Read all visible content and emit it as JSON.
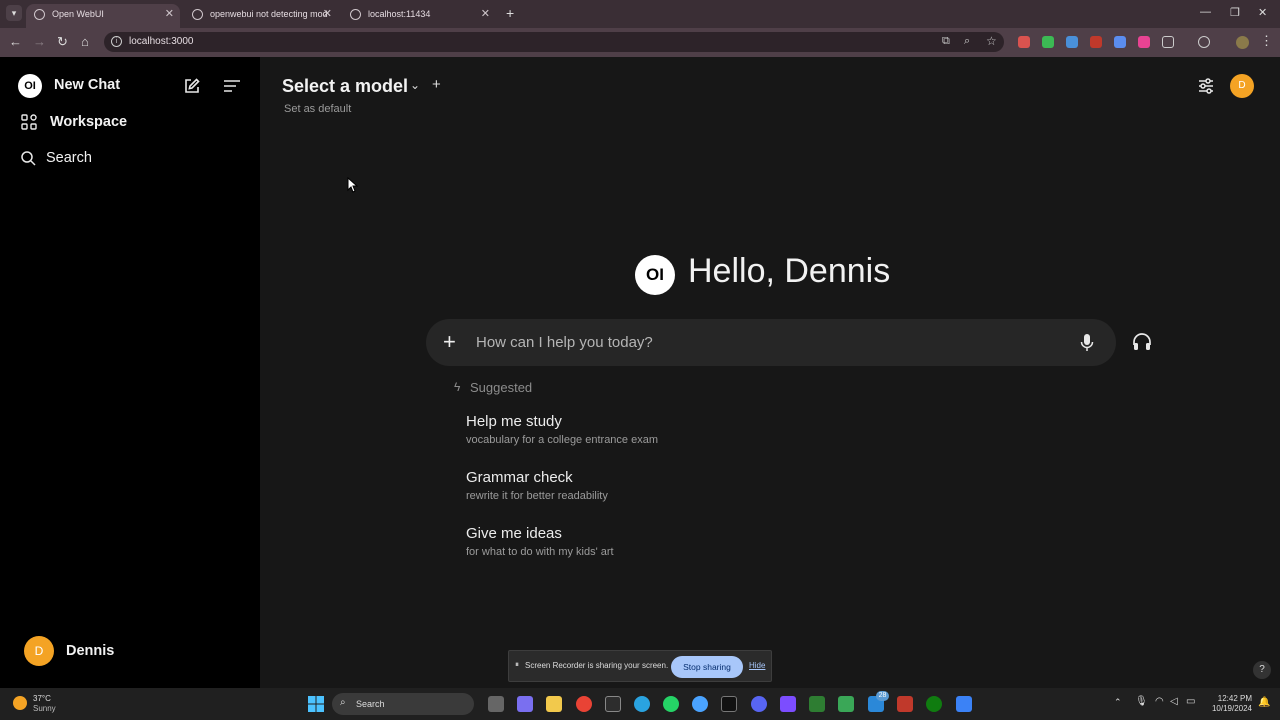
{
  "browser": {
    "tabs": [
      {
        "title": "Open WebUI",
        "active": true
      },
      {
        "title": "openwebui not detecting mod",
        "active": false
      },
      {
        "title": "localhost:11434",
        "active": false
      }
    ],
    "url": "localhost:3000"
  },
  "sidebar": {
    "logo_text": "OI",
    "new_chat": "New Chat",
    "workspace": "Workspace",
    "search": "Search",
    "user_initial": "D",
    "user_name": "Dennis"
  },
  "header": {
    "model_selector": "Select a model",
    "set_default": "Set as default",
    "avatar_initial": "D"
  },
  "hero": {
    "logo_text": "OI",
    "greeting": "Hello, Dennis"
  },
  "chat_input": {
    "placeholder": "How can I help you today?"
  },
  "suggestions": {
    "heading": "Suggested",
    "items": [
      {
        "title": "Help me study",
        "subtitle": "vocabulary for a college entrance exam"
      },
      {
        "title": "Grammar check",
        "subtitle": "rewrite it for better readability"
      },
      {
        "title": "Give me ideas",
        "subtitle": "for what to do with my kids' art"
      }
    ]
  },
  "screen_share": {
    "message": "Screen Recorder is sharing your screen.",
    "stop_label": "Stop sharing",
    "hide_label": "Hide"
  },
  "help_label": "?",
  "taskbar": {
    "weather_temp": "37°C",
    "weather_desc": "Sunny",
    "search_label": "Search",
    "badge_count": "28",
    "time": "12:42 PM",
    "date": "10/19/2024"
  },
  "colors": {
    "accent_avatar": "#f4a324",
    "sidebar_bg": "#000000",
    "main_bg": "#171717",
    "input_bg": "#262626"
  }
}
